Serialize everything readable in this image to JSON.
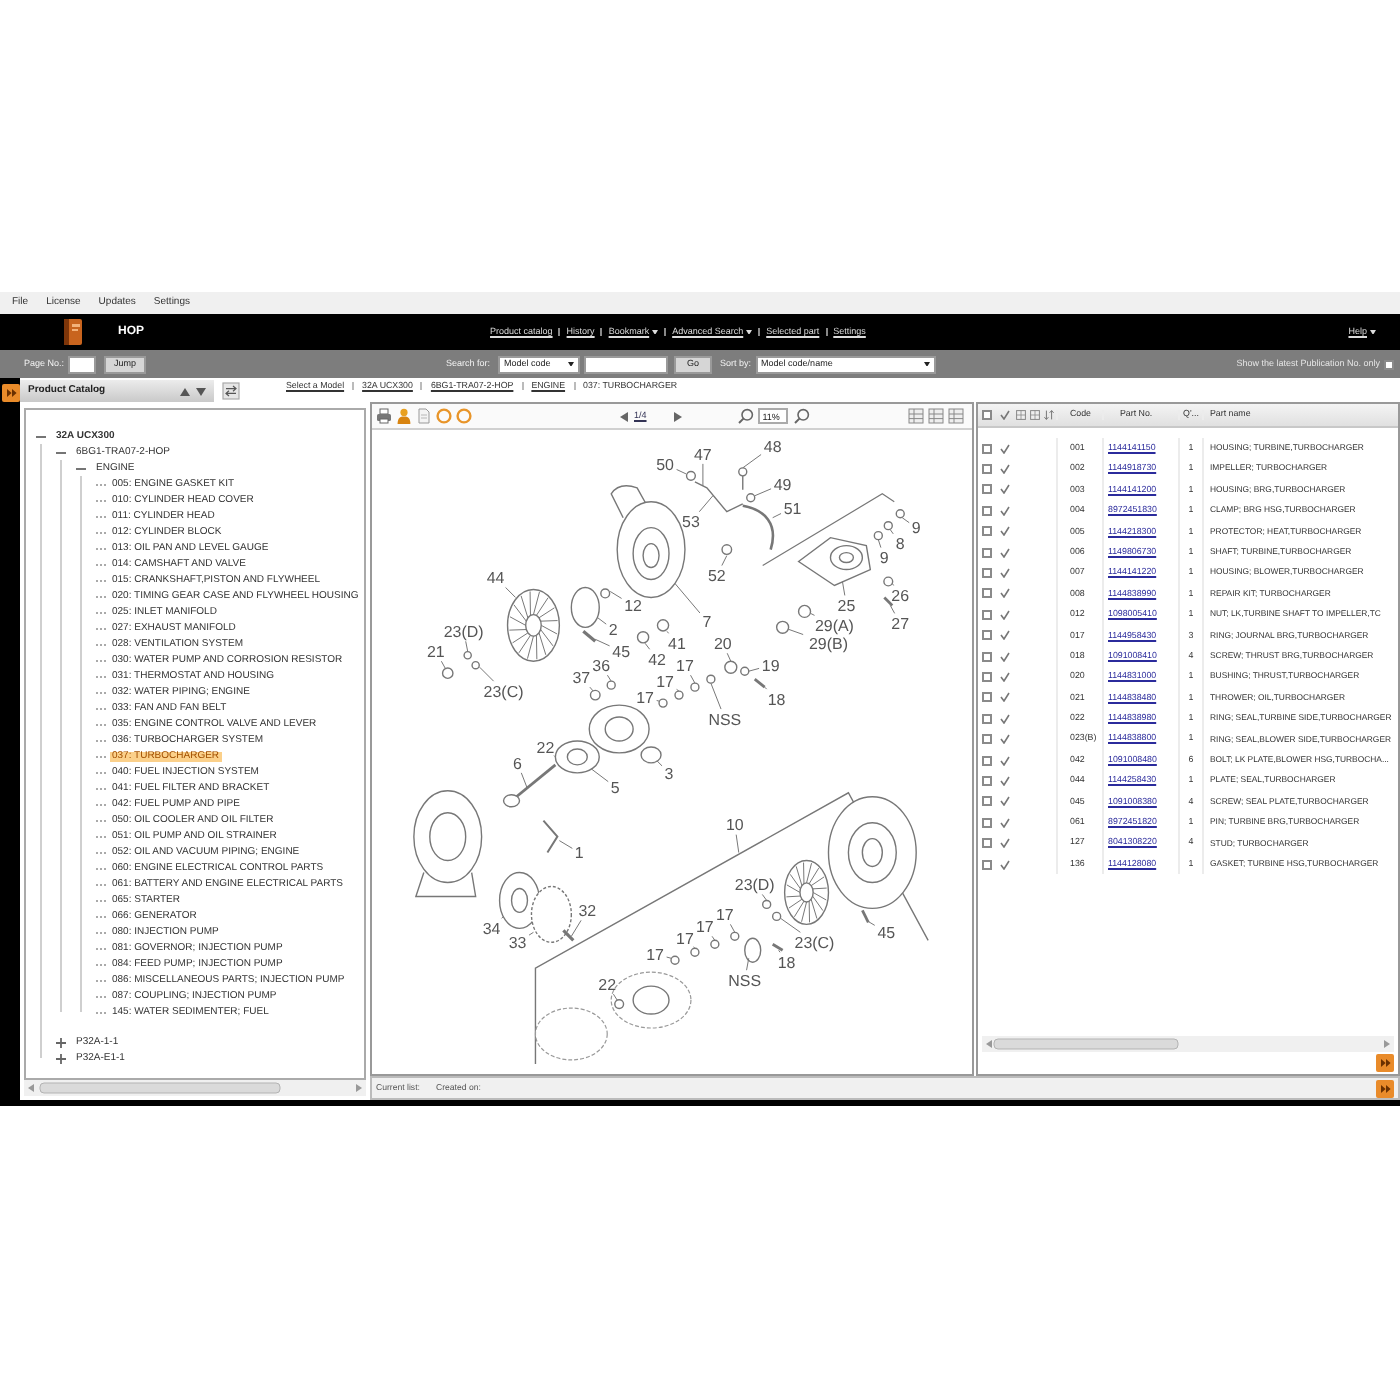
{
  "menu": [
    "File",
    "License",
    "Updates",
    "Settings"
  ],
  "header": {
    "title": "HOP",
    "nav": [
      {
        "label": "Product catalog",
        "dropdown": false
      },
      {
        "label": "History",
        "dropdown": false
      },
      {
        "label": "Bookmark",
        "dropdown": true
      },
      {
        "label": "Advanced Search",
        "dropdown": true
      },
      {
        "label": "Selected part",
        "dropdown": false
      },
      {
        "label": "Settings",
        "dropdown": false
      }
    ],
    "help": {
      "label": "Help",
      "dropdown": true
    }
  },
  "toolbar": {
    "page_label": "Page No.:",
    "jump": "Jump",
    "search_label": "Search for:",
    "search_type": "Model code",
    "go": "Go",
    "sort_label": "Sort by:",
    "sort_value": "Model code/name",
    "latest_label": "Show the latest Publication No. only",
    "latest_checked": false
  },
  "catalog": {
    "title": "Product Catalog",
    "tree": [
      {
        "label": "32A UCX300",
        "expanded": true,
        "selected": false,
        "children": [
          {
            "label": "6BG1-TRA07-2-HOP",
            "expanded": true,
            "selected": false,
            "children": [
              {
                "label": "ENGINE",
                "expanded": true,
                "selected": false,
                "children": [
                  {
                    "label": "005: ENGINE GASKET KIT",
                    "selected": false
                  },
                  {
                    "label": "010: CYLINDER HEAD COVER",
                    "selected": false
                  },
                  {
                    "label": "011: CYLINDER HEAD",
                    "selected": false
                  },
                  {
                    "label": "012: CYLINDER BLOCK",
                    "selected": false
                  },
                  {
                    "label": "013: OIL PAN AND LEVEL GAUGE",
                    "selected": false
                  },
                  {
                    "label": "014: CAMSHAFT AND VALVE",
                    "selected": false
                  },
                  {
                    "label": "015: CRANKSHAFT,PISTON AND FLYWHEEL",
                    "selected": false
                  },
                  {
                    "label": "020: TIMING GEAR CASE AND FLYWHEEL HOUSING",
                    "selected": false
                  },
                  {
                    "label": "025: INLET MANIFOLD",
                    "selected": false
                  },
                  {
                    "label": "027: EXHAUST MANIFOLD",
                    "selected": false
                  },
                  {
                    "label": "028: VENTILATION SYSTEM",
                    "selected": false
                  },
                  {
                    "label": "030: WATER PUMP AND CORROSION RESISTOR",
                    "selected": false
                  },
                  {
                    "label": "031: THERMOSTAT AND HOUSING",
                    "selected": false
                  },
                  {
                    "label": "032: WATER PIPING; ENGINE",
                    "selected": false
                  },
                  {
                    "label": "033: FAN AND FAN BELT",
                    "selected": false
                  },
                  {
                    "label": "035: ENGINE CONTROL VALVE AND LEVER",
                    "selected": false
                  },
                  {
                    "label": "036: TURBOCHARGER SYSTEM",
                    "selected": false
                  },
                  {
                    "label": "037: TURBOCHARGER",
                    "selected": true
                  },
                  {
                    "label": "040: FUEL INJECTION SYSTEM",
                    "selected": false
                  },
                  {
                    "label": "041: FUEL FILTER AND BRACKET",
                    "selected": false
                  },
                  {
                    "label": "042: FUEL PUMP AND PIPE",
                    "selected": false
                  },
                  {
                    "label": "050: OIL COOLER AND OIL FILTER",
                    "selected": false
                  },
                  {
                    "label": "051: OIL PUMP AND OIL STRAINER",
                    "selected": false
                  },
                  {
                    "label": "052: OIL AND VACUUM PIPING; ENGINE",
                    "selected": false
                  },
                  {
                    "label": "060: ENGINE ELECTRICAL CONTROL PARTS",
                    "selected": false
                  },
                  {
                    "label": "061: BATTERY AND ENGINE ELECTRICAL PARTS",
                    "selected": false
                  },
                  {
                    "label": "065: STARTER",
                    "selected": false
                  },
                  {
                    "label": "066: GENERATOR",
                    "selected": false
                  },
                  {
                    "label": "080: INJECTION PUMP",
                    "selected": false
                  },
                  {
                    "label": "081: GOVERNOR; INJECTION PUMP",
                    "selected": false
                  },
                  {
                    "label": "084: FEED PUMP; INJECTION PUMP",
                    "selected": false
                  },
                  {
                    "label": "086: MISCELLANEOUS PARTS; INJECTION PUMP",
                    "selected": false
                  },
                  {
                    "label": "087: COUPLING; INJECTION PUMP",
                    "selected": false
                  },
                  {
                    "label": "145: WATER SEDIMENTER; FUEL",
                    "selected": false
                  }
                ]
              }
            ]
          },
          {
            "label": "P32A-1-1",
            "expanded": false,
            "selected": false
          },
          {
            "label": "P32A-E1-1",
            "expanded": false,
            "selected": false
          }
        ]
      }
    ]
  },
  "breadcrumb": [
    {
      "label": "Select a Model",
      "kind": "link"
    },
    {
      "label": "32A UCX300",
      "kind": "link"
    },
    {
      "label": "6BG1-TRA07-2-HOP",
      "kind": "link"
    },
    {
      "label": "ENGINE",
      "kind": "link"
    },
    {
      "label": "037: TURBOCHARGER",
      "kind": "current"
    }
  ],
  "diagram": {
    "page": "1/4",
    "zoom": "11%",
    "callouts": [
      "50",
      "47",
      "48",
      "49",
      "53",
      "51",
      "9",
      "8",
      "9",
      "44",
      "52",
      "12",
      "25",
      "26",
      "23(D)",
      "2",
      "7",
      "29(A)",
      "27",
      "21",
      "45",
      "41",
      "20",
      "29(B)",
      "36",
      "42",
      "17",
      "19",
      "37",
      "17",
      "23(C)",
      "17",
      "18",
      "NSS",
      "22",
      "6",
      "3",
      "5",
      "10",
      "1",
      "23(D)",
      "32",
      "17",
      "34",
      "17",
      "45",
      "33",
      "17",
      "23(C)",
      "17",
      "18",
      "22",
      "NSS"
    ]
  },
  "parts_table": {
    "all_checked": false,
    "columns": [
      "Code",
      "Part No.",
      "Q'...",
      "Part name"
    ],
    "rows": [
      {
        "code": "001",
        "part_no": "1144141150",
        "qty": "1",
        "name": "HOUSING; TURBINE,TURBOCHARGER",
        "checked": false
      },
      {
        "code": "002",
        "part_no": "1144918730",
        "qty": "1",
        "name": "IMPELLER; TURBOCHARGER",
        "checked": false
      },
      {
        "code": "003",
        "part_no": "1144141200",
        "qty": "1",
        "name": "HOUSING; BRG,TURBOCHARGER",
        "checked": false
      },
      {
        "code": "004",
        "part_no": "8972451830",
        "qty": "1",
        "name": "CLAMP; BRG HSG,TURBOCHARGER",
        "checked": false
      },
      {
        "code": "005",
        "part_no": "1144218300",
        "qty": "1",
        "name": "PROTECTOR; HEAT,TURBOCHARGER",
        "checked": false
      },
      {
        "code": "006",
        "part_no": "1149806730",
        "qty": "1",
        "name": "SHAFT; TURBINE,TURBOCHARGER",
        "checked": false
      },
      {
        "code": "007",
        "part_no": "1144141220",
        "qty": "1",
        "name": "HOUSING; BLOWER,TURBOCHARGER",
        "checked": false
      },
      {
        "code": "008",
        "part_no": "1144838990",
        "qty": "1",
        "name": "REPAIR KIT; TURBOCHARGER",
        "checked": false
      },
      {
        "code": "012",
        "part_no": "1098005410",
        "qty": "1",
        "name": "NUT; LK,TURBINE SHAFT TO IMPELLER,TC",
        "checked": false
      },
      {
        "code": "017",
        "part_no": "1144958430",
        "qty": "3",
        "name": "RING; JOURNAL BRG,TURBOCHARGER",
        "checked": false
      },
      {
        "code": "018",
        "part_no": "1091008410",
        "qty": "4",
        "name": "SCREW; THRUST BRG,TURBOCHARGER",
        "checked": false
      },
      {
        "code": "020",
        "part_no": "1144831000",
        "qty": "1",
        "name": "BUSHING; THRUST,TURBOCHARGER",
        "checked": false
      },
      {
        "code": "021",
        "part_no": "1144838480",
        "qty": "1",
        "name": "THROWER; OIL,TURBOCHARGER",
        "checked": false
      },
      {
        "code": "022",
        "part_no": "1144838980",
        "qty": "1",
        "name": "RING; SEAL,TURBINE SIDE,TURBOCHARGER",
        "checked": false
      },
      {
        "code": "023(B)",
        "part_no": "1144838800",
        "qty": "1",
        "name": "RING; SEAL,BLOWER SIDE,TURBOCHARGER",
        "checked": false
      },
      {
        "code": "042",
        "part_no": "1091008480",
        "qty": "6",
        "name": "BOLT; LK PLATE,BLOWER HSG,TURBOCHA...",
        "checked": false
      },
      {
        "code": "044",
        "part_no": "1144258430",
        "qty": "1",
        "name": "PLATE; SEAL,TURBOCHARGER",
        "checked": false
      },
      {
        "code": "045",
        "part_no": "1091008380",
        "qty": "4",
        "name": "SCREW; SEAL PLATE,TURBOCHARGER",
        "checked": false
      },
      {
        "code": "061",
        "part_no": "8972451820",
        "qty": "1",
        "name": "PIN; TURBINE BRG,TURBOCHARGER",
        "checked": false
      },
      {
        "code": "127",
        "part_no": "8041308220",
        "qty": "4",
        "name": "STUD; TURBOCHARGER",
        "checked": false
      },
      {
        "code": "136",
        "part_no": "1144128080",
        "qty": "1",
        "name": "GASKET; TURBINE HSG,TURBOCHARGER",
        "checked": false
      }
    ]
  },
  "status_bar": {
    "current_list": "Current list:",
    "created_on": "Created on:"
  }
}
